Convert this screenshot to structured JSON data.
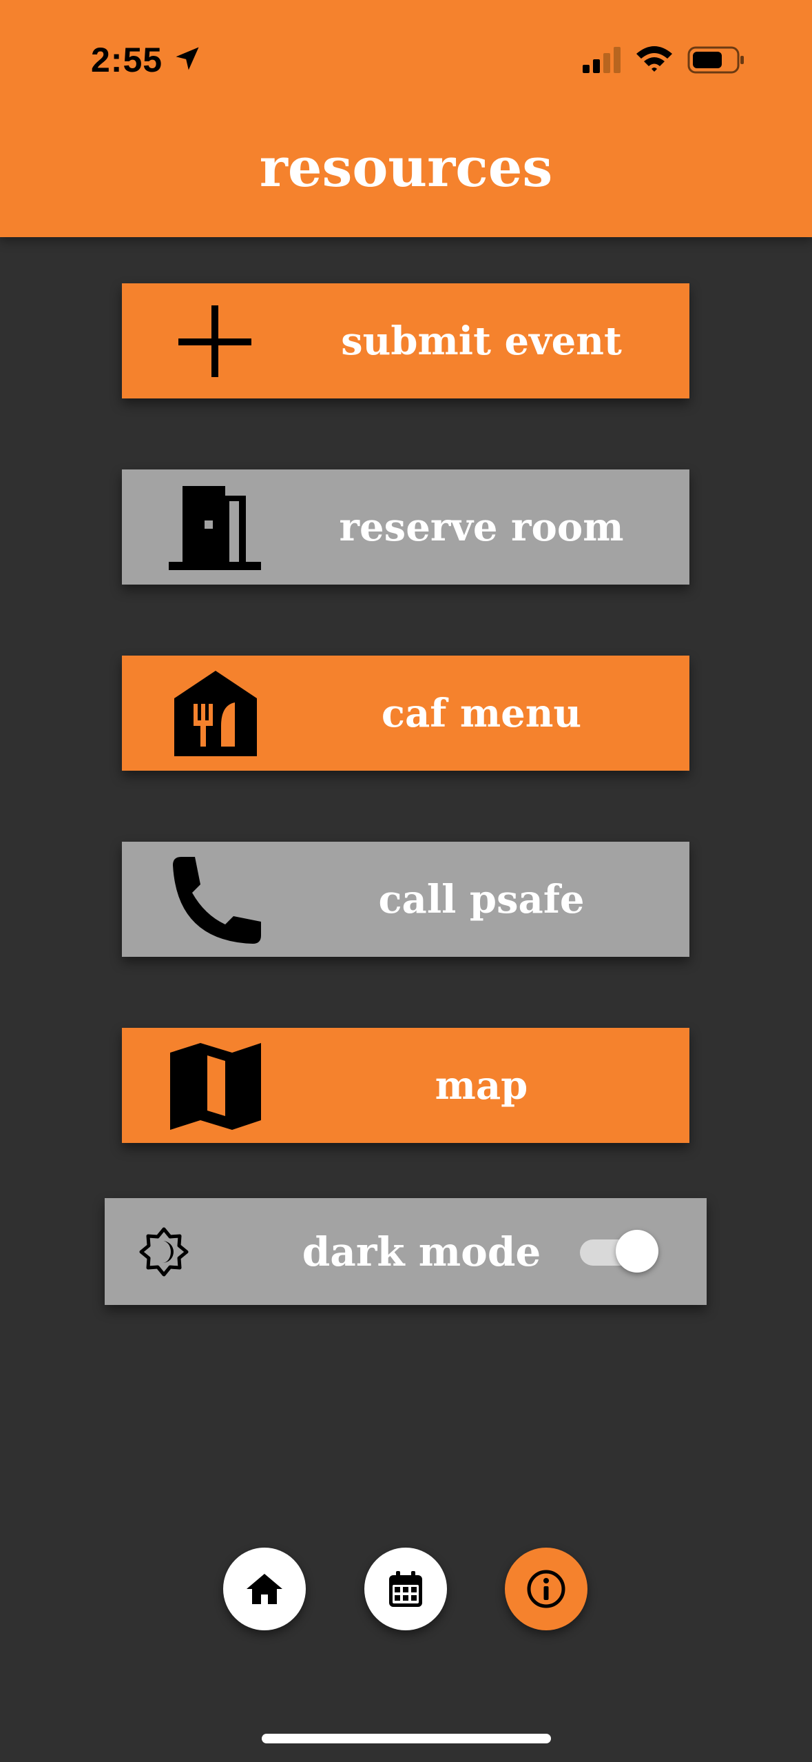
{
  "status_bar": {
    "time": "2:55"
  },
  "header": {
    "title": "resources"
  },
  "buttons": [
    {
      "label": "submit event",
      "icon": "plus-icon",
      "color": "#f5822d"
    },
    {
      "label": "reserve room",
      "icon": "door-icon",
      "color": "#a3a3a3"
    },
    {
      "label": "caf menu",
      "icon": "restaurant-icon",
      "color": "#f5822d"
    },
    {
      "label": "call psafe",
      "icon": "phone-icon",
      "color": "#a3a3a3"
    },
    {
      "label": "map",
      "icon": "map-icon",
      "color": "#f5822d"
    }
  ],
  "dark_mode": {
    "label": "dark mode",
    "icon": "brightness-moon-icon",
    "enabled": true
  },
  "bottom_nav": [
    {
      "name": "home",
      "icon": "home-icon",
      "active": false
    },
    {
      "name": "calendar",
      "icon": "calendar-icon",
      "active": false
    },
    {
      "name": "info",
      "icon": "info-icon",
      "active": true
    }
  ],
  "colors": {
    "accent": "#f5822d",
    "background": "#303030",
    "button_gray": "#a3a3a3"
  }
}
